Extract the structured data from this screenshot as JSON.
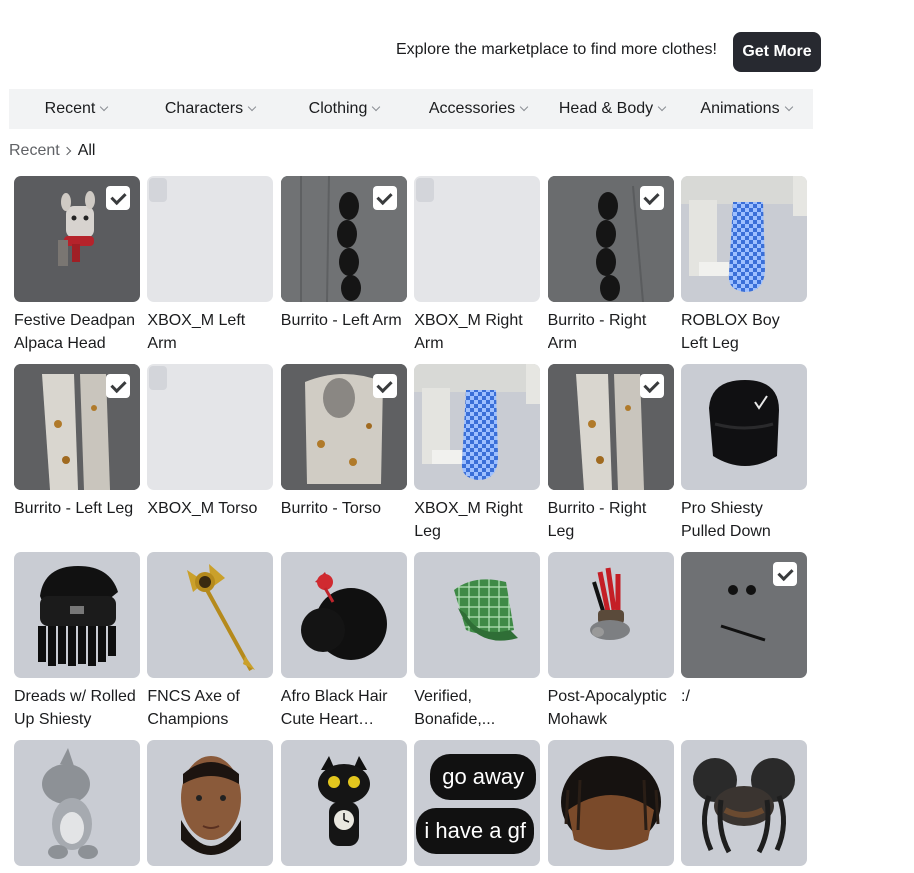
{
  "promo": {
    "text": "Explore the marketplace to find more clothes!",
    "button": "Get More"
  },
  "tabs": [
    "Recent",
    "Characters",
    "Clothing",
    "Accessories",
    "Head & Body",
    "Animations"
  ],
  "breadcrumb": {
    "parent": "Recent",
    "current": "All"
  },
  "items": [
    {
      "name": "Festive Deadpan Alpaca Head",
      "bg": "dark",
      "checked": true,
      "art": "alpaca"
    },
    {
      "name": "XBOX_M Left Arm",
      "bg": "light",
      "checked": false,
      "art": "none"
    },
    {
      "name": "Burrito - Left Arm",
      "bg": "dark",
      "checked": true,
      "art": "arm-left"
    },
    {
      "name": "XBOX_M Right Arm",
      "bg": "light",
      "checked": false,
      "art": "none"
    },
    {
      "name": "Burrito - Right Arm",
      "bg": "dark",
      "checked": true,
      "art": "arm-right"
    },
    {
      "name": "ROBLOX Boy Left Leg",
      "bg": "normal",
      "checked": false,
      "art": "blue-leg"
    },
    {
      "name": "Burrito - Left Leg",
      "bg": "dark",
      "checked": true,
      "art": "burrito-leg"
    },
    {
      "name": "XBOX_M Torso",
      "bg": "light",
      "checked": false,
      "art": "none"
    },
    {
      "name": "Burrito - Torso",
      "bg": "dark",
      "checked": true,
      "art": "burrito-torso"
    },
    {
      "name": "XBOX_M Right Leg",
      "bg": "normal",
      "checked": false,
      "art": "blue-leg"
    },
    {
      "name": "Burrito - Right Leg",
      "bg": "dark",
      "checked": true,
      "art": "burrito-leg"
    },
    {
      "name": "Pro Shiesty Pulled Down",
      "bg": "normal",
      "checked": false,
      "art": "shiesty"
    },
    {
      "name": "Dreads w/ Rolled Up Shiesty",
      "bg": "normal",
      "checked": false,
      "art": "dreads"
    },
    {
      "name": "FNCS Axe of Champions",
      "bg": "normal",
      "checked": false,
      "art": "axe"
    },
    {
      "name": "Afro Black Hair Cute Heart Fork...",
      "bg": "normal",
      "checked": false,
      "art": "afro"
    },
    {
      "name": "Verified, Bonafide,...",
      "bg": "normal",
      "checked": false,
      "art": "cap"
    },
    {
      "name": "Post-Apocalyptic Mohawk",
      "bg": "normal",
      "checked": false,
      "art": "mohawk"
    },
    {
      "name": ":/",
      "bg": "grey",
      "checked": true,
      "art": "face"
    },
    {
      "name": "",
      "bg": "normal",
      "checked": false,
      "art": "shark"
    },
    {
      "name": "",
      "bg": "normal",
      "checked": false,
      "art": "head"
    },
    {
      "name": "",
      "bg": "normal",
      "checked": false,
      "art": "cat"
    },
    {
      "name": "",
      "bg": "normal",
      "checked": false,
      "art": "text-bubbles",
      "bubbles": [
        "go away",
        "i have a gf"
      ]
    },
    {
      "name": "",
      "bg": "normal",
      "checked": false,
      "art": "twists"
    },
    {
      "name": "",
      "bg": "normal",
      "checked": false,
      "art": "buns"
    }
  ]
}
